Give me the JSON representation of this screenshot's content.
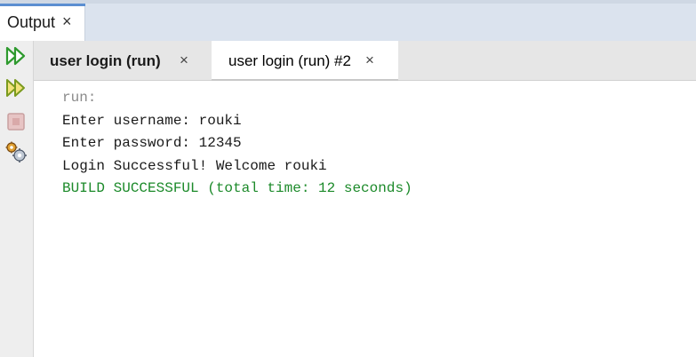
{
  "window_tab": {
    "label": "Output",
    "close": "×"
  },
  "toolbar": {
    "rerun_icon": "double-play-green",
    "rerun_with_params_icon": "double-play-yellow",
    "stop_icon": "stop-square",
    "settings_icon": "gear-cluster"
  },
  "subtabs": [
    {
      "label": "user login (run)",
      "close": "×",
      "active": true
    },
    {
      "label": "user login (run) #2",
      "close": "×",
      "active": false
    }
  ],
  "console": {
    "lines": [
      "run:",
      "Enter username: rouki",
      "Enter password: 12345",
      "Login Successful! Welcome rouki",
      "BUILD SUCCESSFUL (total time: 12 seconds)"
    ]
  },
  "colors": {
    "build_success": "#1c8a2a",
    "run_label": "#8a8a8a",
    "accent": "#5b8fd1"
  }
}
